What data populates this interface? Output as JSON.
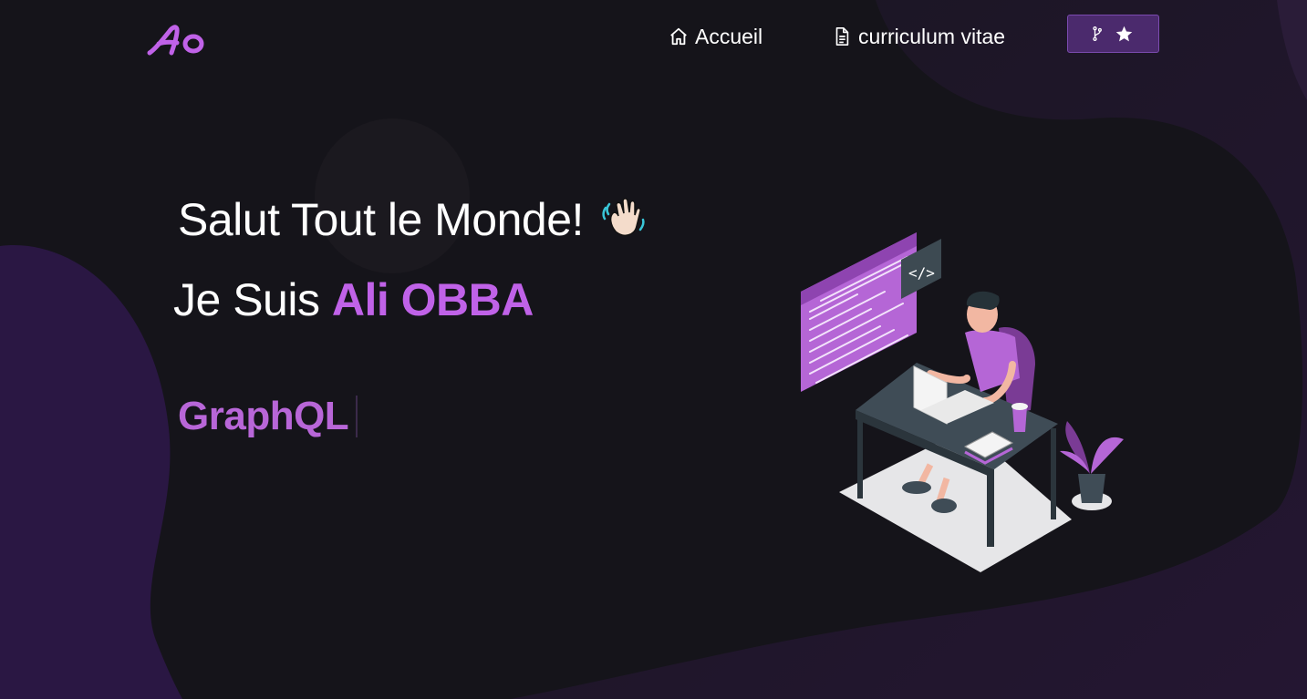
{
  "brand": {
    "logo_text": "Ao",
    "accent": "#c062e8"
  },
  "nav": {
    "home": {
      "label": "Accueil",
      "icon": "home-icon"
    },
    "cv": {
      "label": "curriculum vitae",
      "icon": "document-icon"
    },
    "github_button": {
      "icons": [
        "fork-icon",
        "star-icon"
      ]
    }
  },
  "hero": {
    "greeting": "Salut Tout le Monde!",
    "greeting_emoji": "waving-hand-icon",
    "intro_prefix": "Je Suis",
    "name": "Ali OBBA",
    "typed_text": "GraphQL"
  },
  "colors": {
    "background": "#15141a",
    "name_purple": "#c062e8",
    "typed_purple": "#b866d8",
    "button_bg": "#4b2a6d"
  }
}
